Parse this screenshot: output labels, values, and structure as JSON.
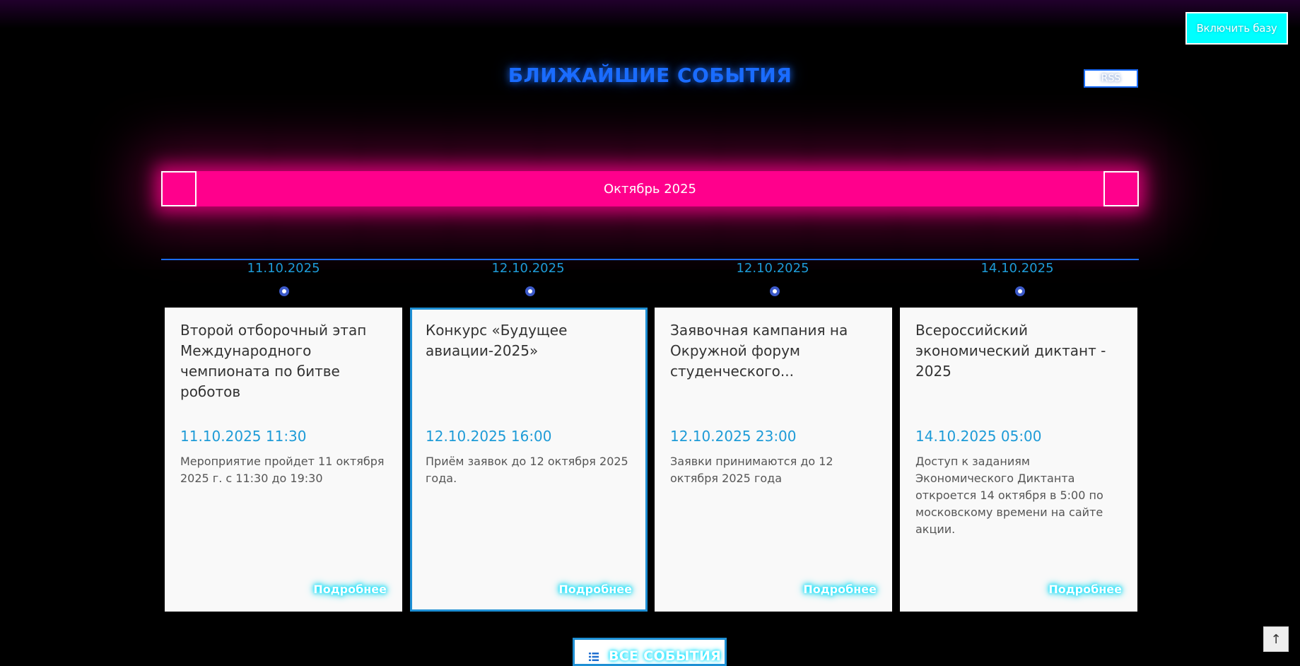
{
  "header": {
    "base_button": "Включить базу",
    "title": "БЛИЖАЙШИЕ СОБЫТИЯ",
    "rss": "RSS"
  },
  "calendar": {
    "month": "Октябрь 2025",
    "prev_icon": "chevron-left-icon",
    "next_icon": "chevron-right-icon"
  },
  "timeline": {
    "dates": [
      "11.10.2025",
      "12.10.2025",
      "12.10.2025",
      "14.10.2025"
    ]
  },
  "events": [
    {
      "title": "Второй отборочный этап Международного чемпионата по битве роботов",
      "time": "11.10.2025 11:30",
      "description": "Мероприятие пройдет 11 октября 2025 г. с 11:30 до 19:30",
      "more": "Подробнее"
    },
    {
      "title": "Конкурс «Будущее авиации-2025»",
      "time": "12.10.2025 16:00",
      "description": "Приём заявок до 12 октября 2025 года.",
      "more": "Подробнее"
    },
    {
      "title": "Заявочная кампания на Окружной форум студенческого...",
      "time": "12.10.2025 23:00",
      "description": "Заявки принимаются до 12 октября 2025 года",
      "more": "Подробнее"
    },
    {
      "title": "Всероссийский экономический диктант - 2025",
      "time": "14.10.2025 05:00",
      "description": "Доступ к заданиям Экономического Диктанта откроется 14 октября в 5:00 по московскому времени на сайте акции.",
      "more": "Подробнее"
    }
  ],
  "footer": {
    "all_events": "ВСЕ СОБЫТИЯ",
    "all_events_icon": "list-icon",
    "scroll_top": "↑"
  },
  "colors": {
    "accent_pink": "#ff008c",
    "accent_blue": "#1a6cff",
    "accent_cyan": "#00ffff",
    "date_blue": "#1e9bd7"
  }
}
